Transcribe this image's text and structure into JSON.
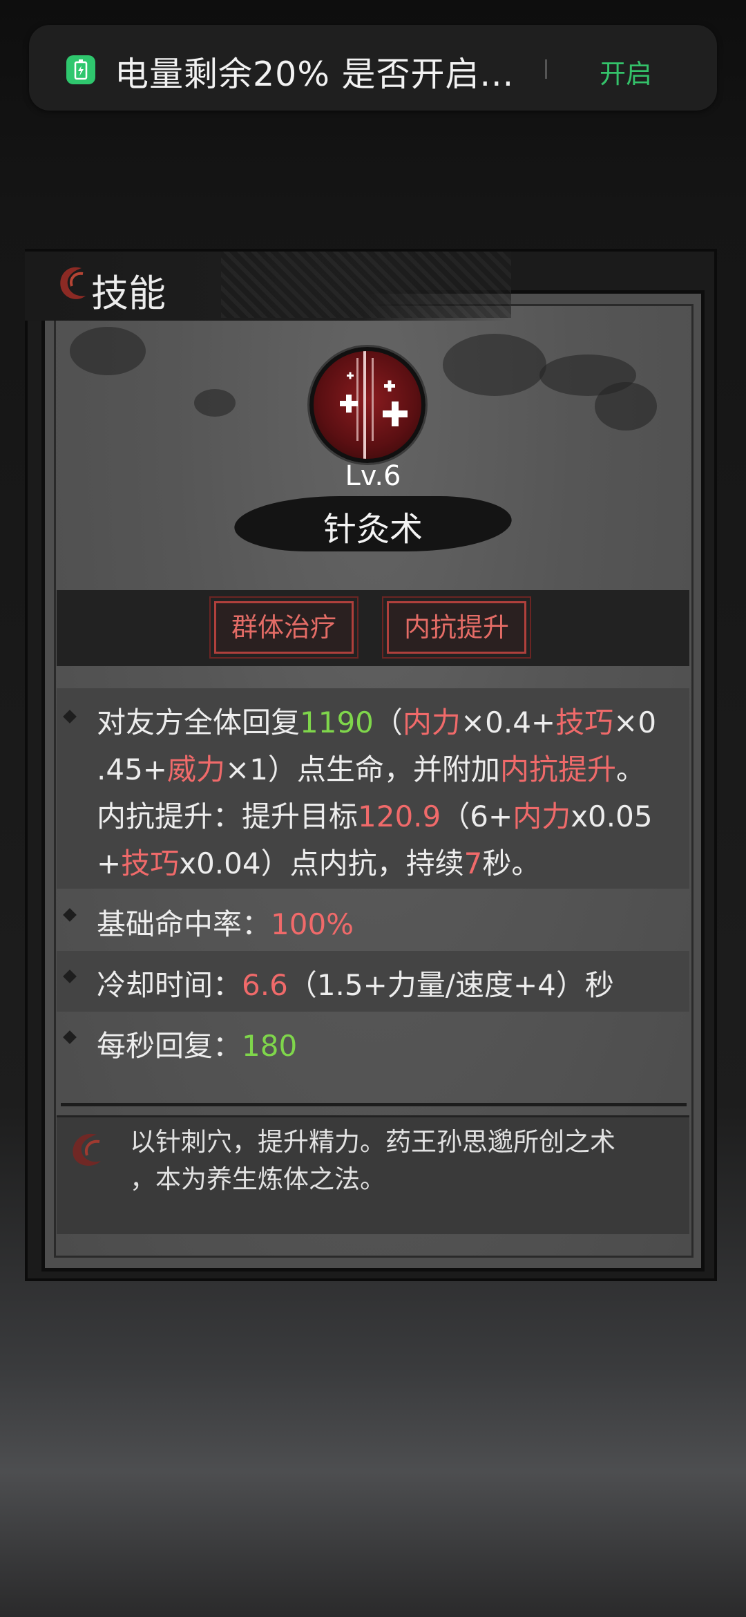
{
  "notification": {
    "text": "电量剩余20% 是否开启...",
    "action": "开启",
    "icon": "battery-saver-icon"
  },
  "panel": {
    "title": "技能",
    "skill": {
      "level": "Lv.6",
      "name": "针灸术",
      "icon": "acupuncture-skill-icon"
    },
    "tags": [
      "群体治疗",
      "内抗提升"
    ],
    "description": {
      "l1": [
        "对友方全体回复",
        "1190",
        "（",
        "内力",
        "×0.4+",
        "技巧",
        "×0"
      ],
      "l2": [
        ".45+",
        "威力",
        "×1）点生命，并附加",
        "内抗提升",
        "。"
      ],
      "l3": [
        "内抗提升：提升目标",
        "120.9",
        "（6+",
        "内力",
        "x0.05"
      ],
      "l4": [
        "+",
        "技巧",
        "x0.04）点内抗，持续",
        "7",
        "秒。"
      ]
    },
    "stats": {
      "hit_label": "基础命中率：",
      "hit_value": "100%",
      "cd_label": "冷却时间：",
      "cd_value": "6.6",
      "cd_formula": "（1.5+力量/速度+4）秒",
      "regen_label": "每秒回复：",
      "regen_value": "180"
    },
    "lore": {
      "line1": "以针刺穴，提升精力。药王孙思邈所创之术",
      "line2": "，本为养生炼体之法。"
    }
  },
  "colors": {
    "green_value": "#7fd64b",
    "red_value": "#f06a6a",
    "tag_border": "#b0403c",
    "notif_action": "#34c26a"
  }
}
